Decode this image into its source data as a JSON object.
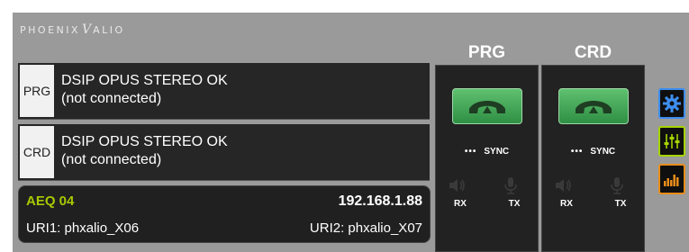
{
  "brand": {
    "left": "PHOENIX",
    "right": "ALIO",
    "mark": "V"
  },
  "rows": [
    {
      "tag": "PRG",
      "line1": "DSIP OPUS STEREO OK",
      "line2": "(not connected)"
    },
    {
      "tag": "CRD",
      "line1": "DSIP OPUS STEREO OK",
      "line2": "(not connected)"
    }
  ],
  "info": {
    "device": "AEQ 04",
    "ip": "192.168.1.88",
    "uri1": "URI1: phxalio_X06",
    "uri2": "URI2: phxalio_X07"
  },
  "channels": [
    {
      "name": "PRG",
      "dots": "•••",
      "sync": "SYNC",
      "rx": "RX",
      "tx": "TX"
    },
    {
      "name": "CRD",
      "dots": "•••",
      "sync": "SYNC",
      "rx": "RX",
      "tx": "TX"
    }
  ],
  "side_buttons": [
    {
      "icon": "gear-icon",
      "color": "#3d8ef0"
    },
    {
      "icon": "mixer-faders-icon",
      "color": "#a6d400"
    },
    {
      "icon": "level-meter-icon",
      "color": "#e88d1a"
    }
  ],
  "colors": {
    "panel": "#9a9a9a",
    "device_name": "#a8c800",
    "call_green": "#3fa556"
  }
}
